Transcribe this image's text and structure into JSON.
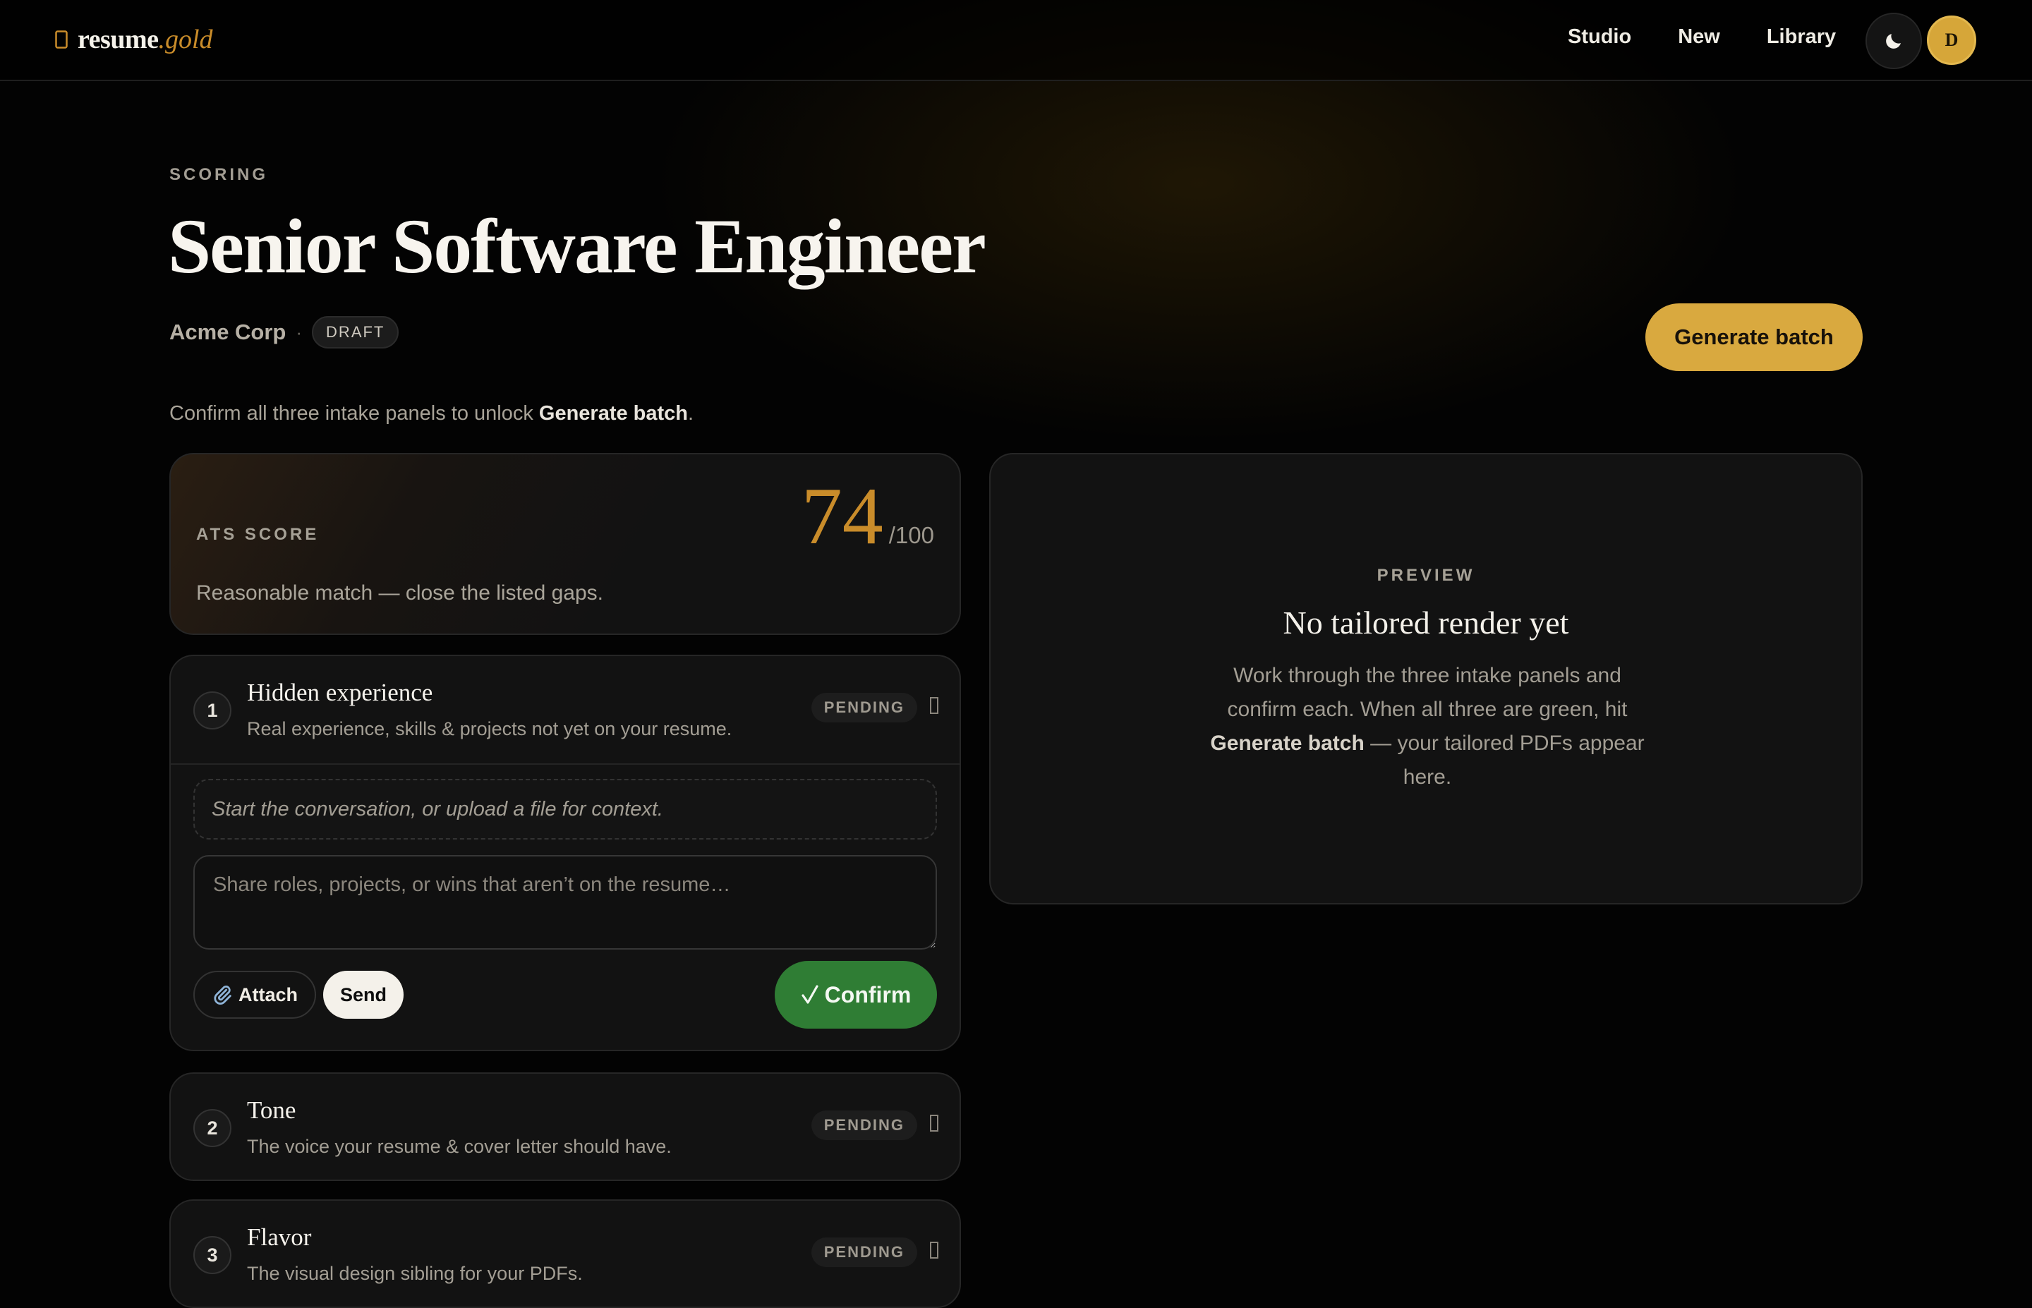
{
  "brand": {
    "name": "resume",
    "accent": ".gold",
    "icon": "document-icon"
  },
  "nav": [
    {
      "label": "Studio"
    },
    {
      "label": "New"
    },
    {
      "label": "Library"
    }
  ],
  "theme_toggle": {
    "icon": "moon-icon"
  },
  "avatar": {
    "initial": "D"
  },
  "header": {
    "eyebrow": "SCORING",
    "title": "Senior Software Engineer",
    "company": "Acme Corp",
    "separator": "·",
    "status": "DRAFT",
    "generate_label": "Generate batch"
  },
  "hint": {
    "prefix": "Confirm all three intake panels to unlock ",
    "strong": "Generate batch",
    "suffix": "."
  },
  "ats": {
    "label": "ATS SCORE",
    "score": "74",
    "max": "/100",
    "description": "Reasonable match — close the listed gaps."
  },
  "preview": {
    "eyebrow": "PREVIEW",
    "title": "No tailored render yet",
    "body_prefix": "Work through the three intake panels and confirm each. When all three are green, hit ",
    "body_strong": "Generate batch",
    "body_suffix": " — your tailored PDFs appear here."
  },
  "panels": [
    {
      "number": "1",
      "title": "Hidden experience",
      "subtitle": "Real experience, skills & projects not yet on your resume.",
      "status": "PENDING",
      "conversation_hint": "Start the conversation, or upload a file for context.",
      "message_placeholder": "Share roles, projects, or wins that aren’t on the resume…",
      "attach_label": "Attach",
      "send_label": "Send",
      "confirm_label": "Confirm"
    },
    {
      "number": "2",
      "title": "Tone",
      "subtitle": "The voice your resume & cover letter should have.",
      "status": "PENDING"
    },
    {
      "number": "3",
      "title": "Flavor",
      "subtitle": "The visual design sibling for your PDFs.",
      "status": "PENDING"
    }
  ],
  "colors": {
    "accent_gold": "#d9a93f",
    "score_gold": "#c98c2a",
    "confirm_green": "#2f7d34",
    "background": "#030303"
  }
}
